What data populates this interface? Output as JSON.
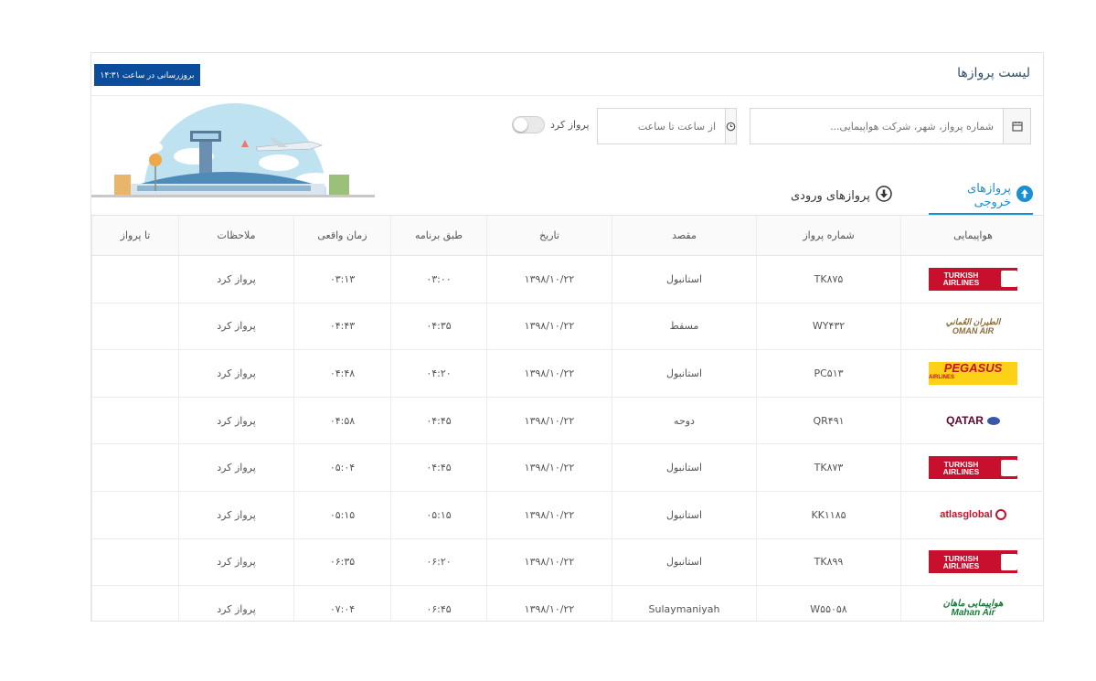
{
  "header": {
    "title": "لیست پروازها",
    "update_label": "بروزرسانی در ساعت ۱۴:۳۱"
  },
  "filters": {
    "search_placeholder": "شماره پرواز، شهر، شرکت هواپیمایی...",
    "time_placeholder": "از ساعت تا ساعت",
    "toggle_label": "پرواز کرد",
    "toggle_on": false
  },
  "tabs": [
    {
      "label": "پروازهای خروجی",
      "active": true
    },
    {
      "label": "پروازهای ورودی",
      "active": false
    }
  ],
  "table": {
    "columns": [
      "هواپیمایی",
      "شماره پرواز",
      "مقصد",
      "تاریخ",
      "طبق برنامه",
      "زمان واقعی",
      "ملاحظات",
      "تا پرواز"
    ],
    "rows": [
      {
        "airline": "TURKISH AIRLINES",
        "logo": "turkish",
        "flight": "TK۸۷۵",
        "dest": "استانبول",
        "date": "۱۳۹۸/۱۰/۲۲",
        "scheduled": "۰۳:۰۰",
        "actual": "۰۳:۱۳",
        "status": "پرواز کرد",
        "remaining": ""
      },
      {
        "airline": "OMAN AIR",
        "logo": "oman",
        "flight": "WY۴۳۲",
        "dest": "مسقط",
        "date": "۱۳۹۸/۱۰/۲۲",
        "scheduled": "۰۴:۳۵",
        "actual": "۰۴:۴۳",
        "status": "پرواز کرد",
        "remaining": ""
      },
      {
        "airline": "PEGASUS",
        "logo": "pegasus",
        "flight": "PC۵۱۳",
        "dest": "استانبول",
        "date": "۱۳۹۸/۱۰/۲۲",
        "scheduled": "۰۴:۲۰",
        "actual": "۰۴:۴۸",
        "status": "پرواز کرد",
        "remaining": ""
      },
      {
        "airline": "QATAR",
        "logo": "qatar",
        "flight": "QR۴۹۱",
        "dest": "دوحه",
        "date": "۱۳۹۸/۱۰/۲۲",
        "scheduled": "۰۴:۴۵",
        "actual": "۰۴:۵۸",
        "status": "پرواز کرد",
        "remaining": ""
      },
      {
        "airline": "TURKISH AIRLINES",
        "logo": "turkish",
        "flight": "TK۸۷۳",
        "dest": "استانبول",
        "date": "۱۳۹۸/۱۰/۲۲",
        "scheduled": "۰۴:۴۵",
        "actual": "۰۵:۰۴",
        "status": "پرواز کرد",
        "remaining": ""
      },
      {
        "airline": "atlasglobal",
        "logo": "atlas",
        "flight": "KK۱۱۸۵",
        "dest": "استانبول",
        "date": "۱۳۹۸/۱۰/۲۲",
        "scheduled": "۰۵:۱۵",
        "actual": "۰۵:۱۵",
        "status": "پرواز کرد",
        "remaining": ""
      },
      {
        "airline": "TURKISH AIRLINES",
        "logo": "turkish",
        "flight": "TK۸۹۹",
        "dest": "استانبول",
        "date": "۱۳۹۸/۱۰/۲۲",
        "scheduled": "۰۶:۲۰",
        "actual": "۰۶:۳۵",
        "status": "پرواز کرد",
        "remaining": ""
      },
      {
        "airline": "Mahan Air",
        "logo": "mahan",
        "flight": "W۵۵۰۵۸",
        "dest": "Sulaymaniyah",
        "date": "۱۳۹۸/۱۰/۲۲",
        "scheduled": "۰۶:۴۵",
        "actual": "۰۷:۰۴",
        "status": "پرواز کرد",
        "remaining": ""
      }
    ]
  },
  "colors": {
    "primary": "#0b4d9a",
    "tab_active": "#1a8fd1",
    "turkish": "#c8102e",
    "pegasus": "#fcd116"
  }
}
